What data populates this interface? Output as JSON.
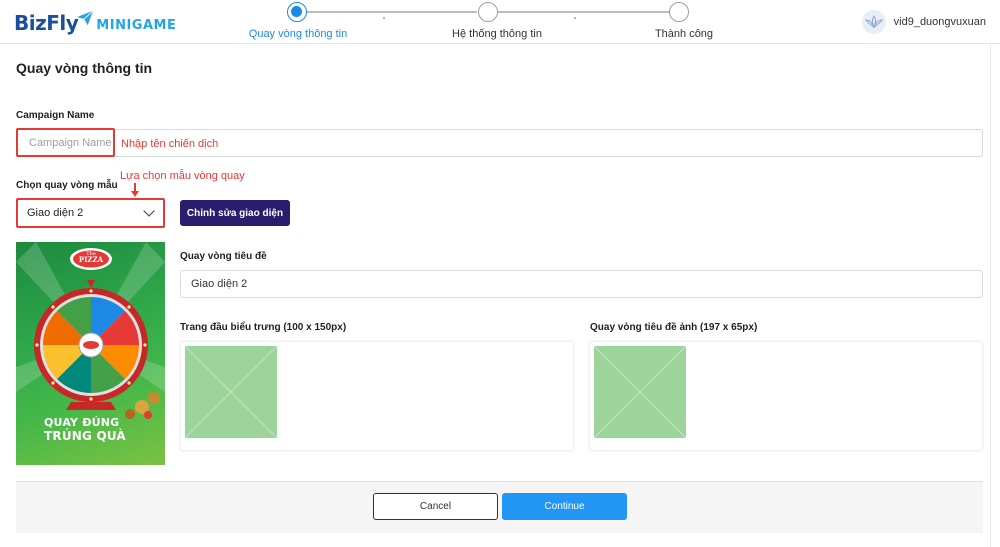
{
  "header": {
    "logo_brand": "BizFly",
    "logo_product": "MINIGAME",
    "steps": [
      {
        "label": "Quay vòng thông tin",
        "active": true
      },
      {
        "label": "Hệ thống thông tin",
        "active": false
      },
      {
        "label": "Thành công",
        "active": false
      }
    ],
    "username": "vid9_duongvuxuan"
  },
  "main": {
    "title": "Quay vòng thông tin",
    "campaign": {
      "label": "Campaign Name",
      "placeholder": "Campaign Name",
      "value": "",
      "annotation": "Nhập tên chiến dịch"
    },
    "template": {
      "label": "Chọn quay vòng mẫu",
      "selected": "Giao diện 2",
      "annotation": "Lựa chọn mẫu vòng quay",
      "edit_button": "Chỉnh sửa giao diện"
    },
    "preview": {
      "brand": "PIZZA",
      "brand_small": "The",
      "slogan_line1": "QUAY ĐÚNG",
      "slogan_line2": "TRÚNG QUÀ"
    },
    "title_field": {
      "label": "Quay vòng tiêu đề",
      "value": "Giao diện 2"
    },
    "logo_field": {
      "label": "Trang đầu biểu trưng (100 x 150px)"
    },
    "title_image_field": {
      "label": "Quay vòng tiêu đề ảnh (197 x 65px)"
    }
  },
  "footer": {
    "cancel": "Cancel",
    "continue": "Continue"
  },
  "colors": {
    "accent": "#1e88e5",
    "primary_dark": "#2a1d6e",
    "annotation": "#e53935",
    "continue": "#2196f3"
  }
}
